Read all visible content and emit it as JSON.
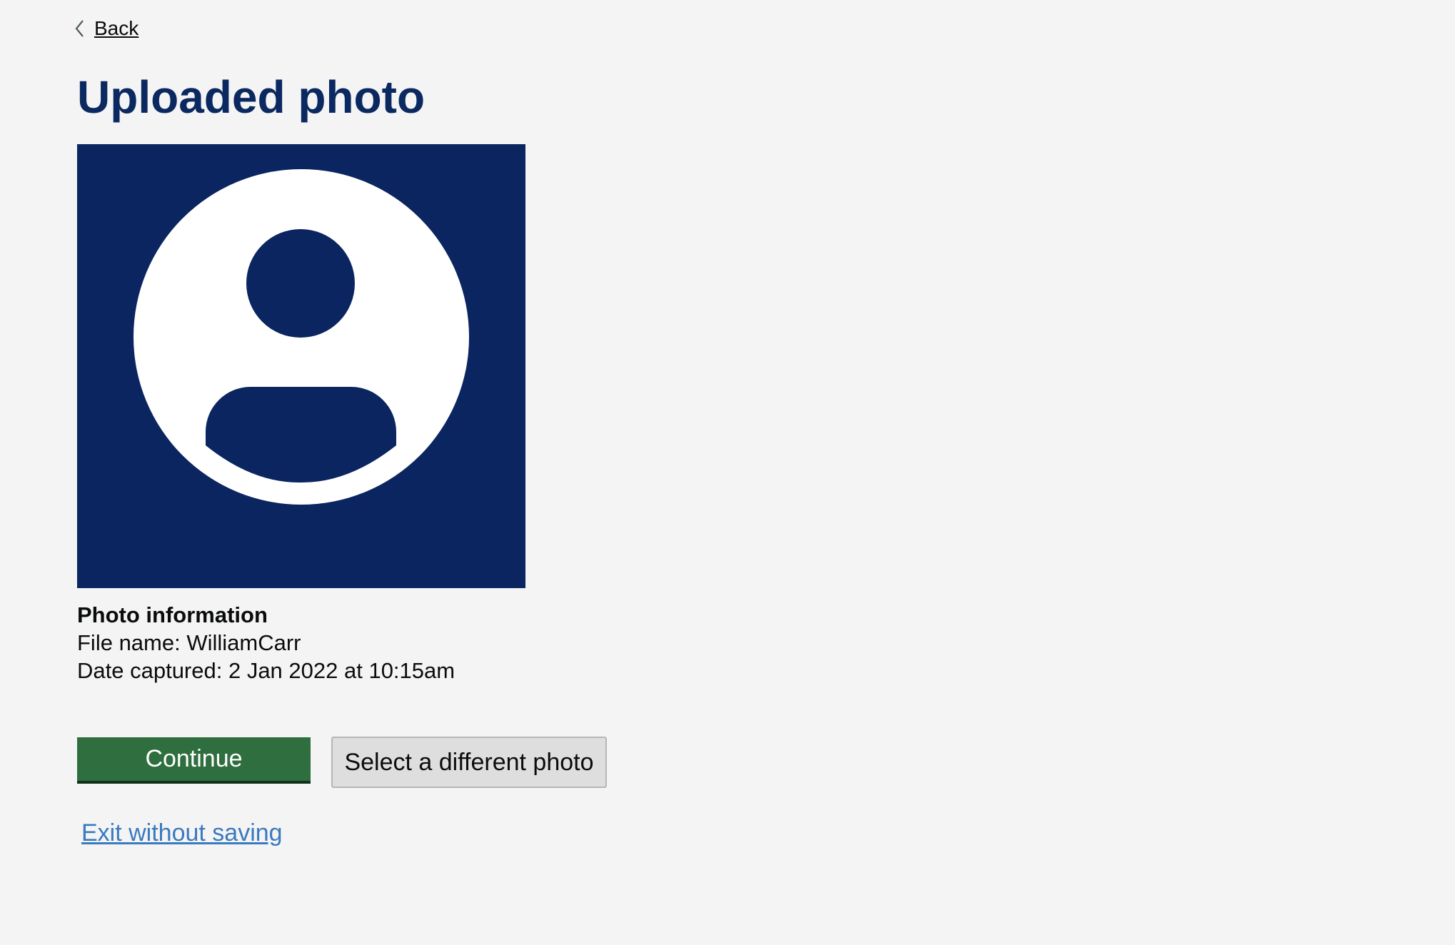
{
  "nav": {
    "back_label": "Back",
    "back_icon": "chevron-left-icon"
  },
  "page": {
    "title": "Uploaded photo"
  },
  "photo": {
    "placeholder_icon": "user-avatar-icon",
    "background_color": "#0b2560",
    "foreground_color": "#ffffff"
  },
  "photo_info": {
    "heading": "Photo information",
    "file_name": "File name: WilliamCarr",
    "date_captured": "Date captured: 2 Jan 2022 at 10:15am"
  },
  "actions": {
    "continue_label": "Continue",
    "continue_color": "#2f6e3f",
    "select_different_label": "Select a different photo",
    "exit_label": "Exit without saving",
    "exit_color": "#3a7ac0"
  }
}
